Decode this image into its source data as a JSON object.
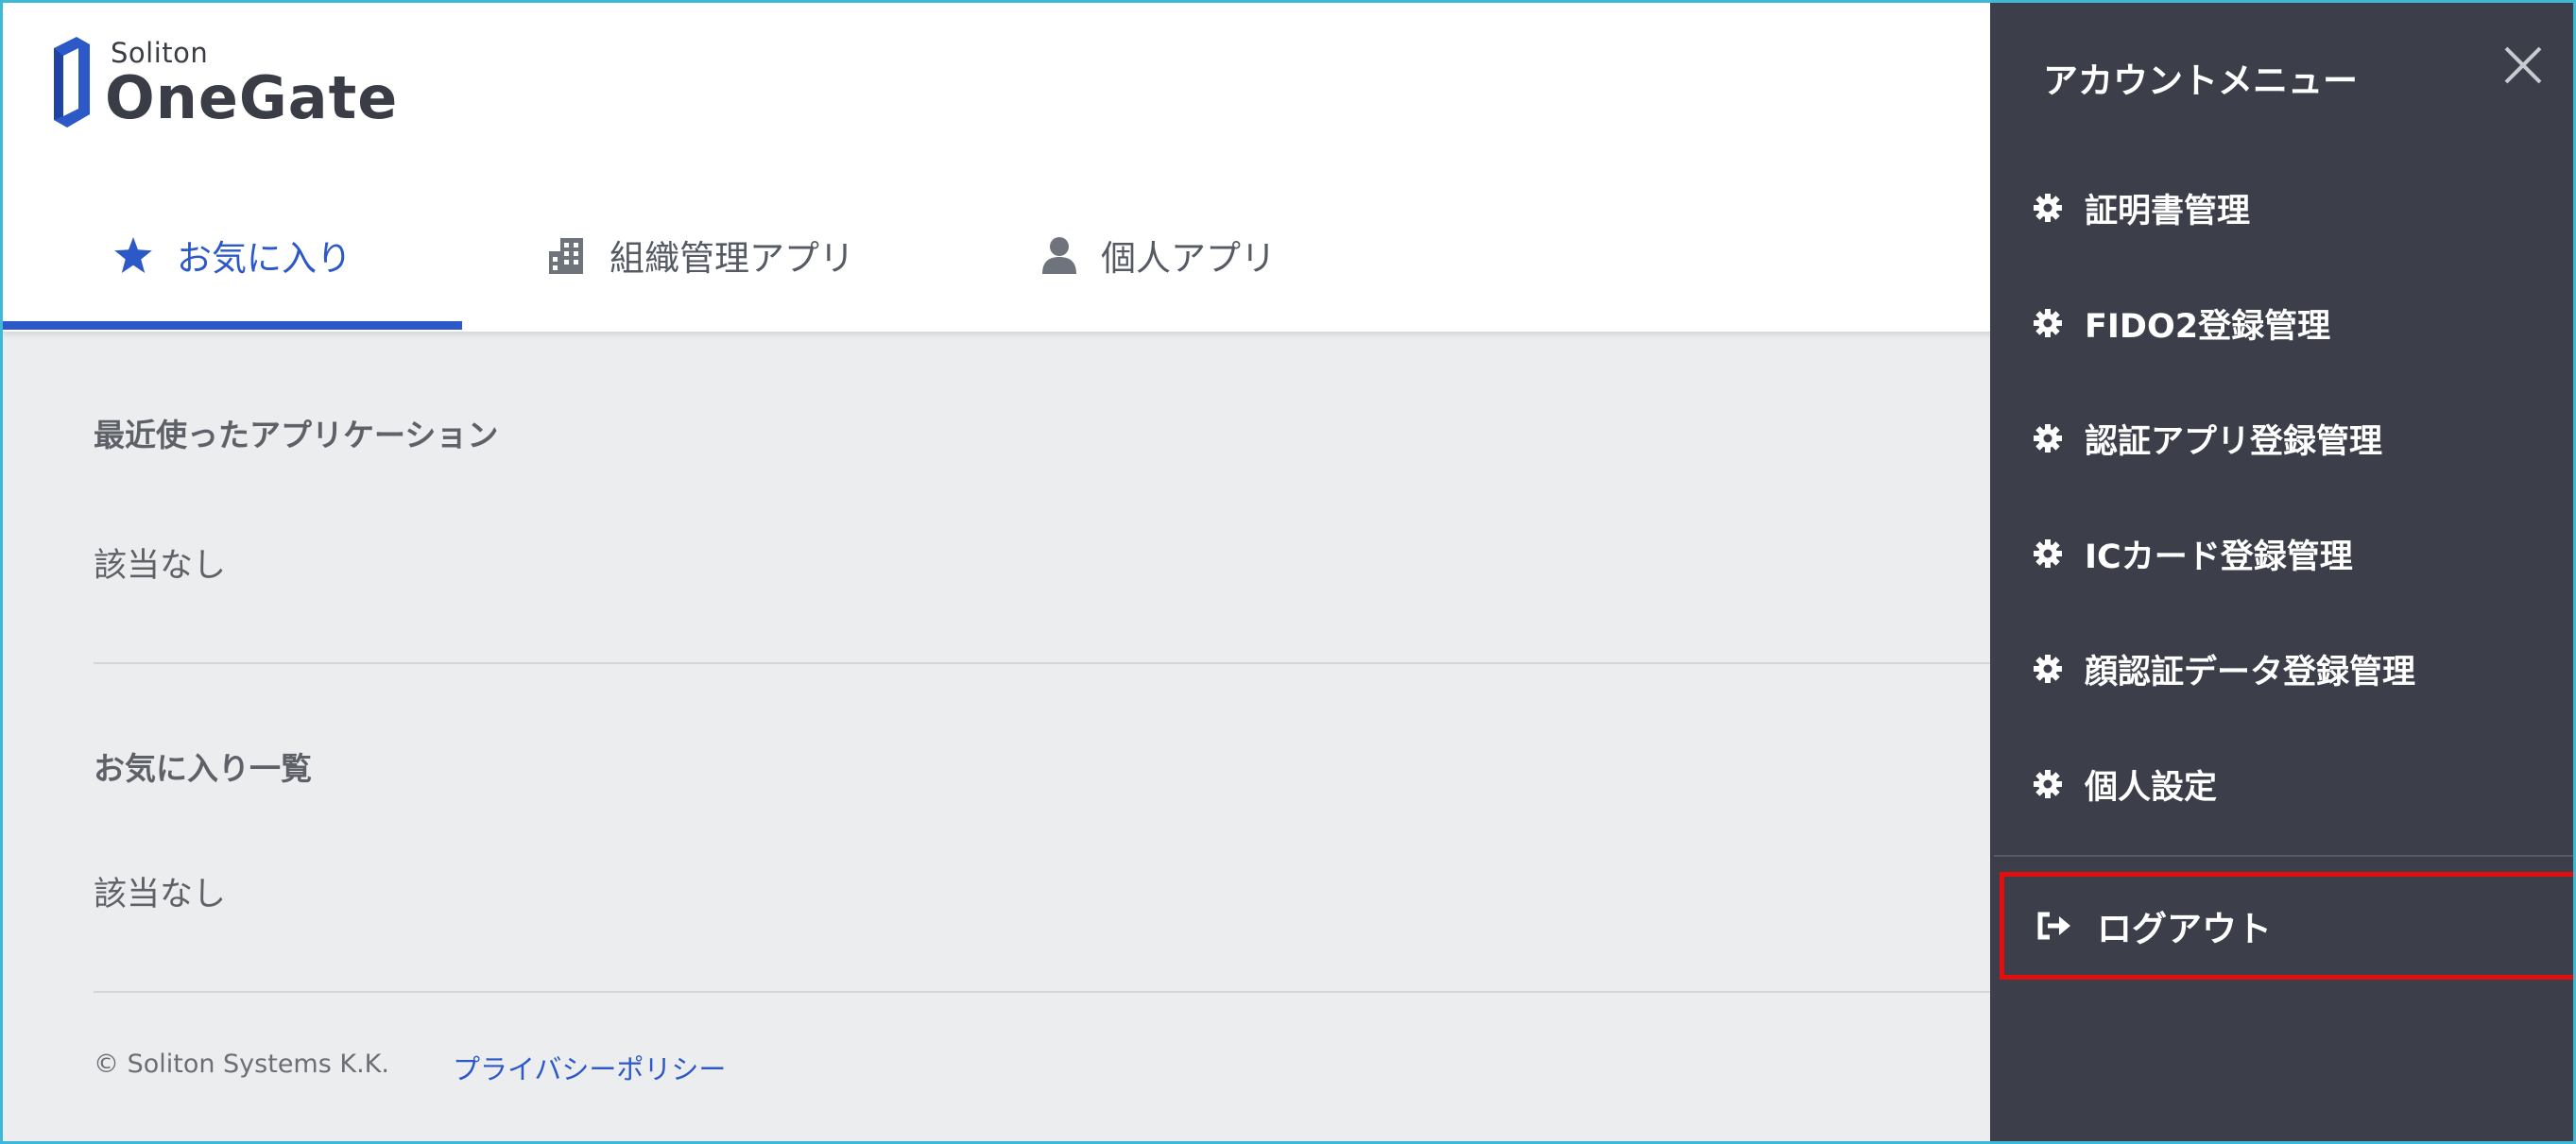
{
  "brand": {
    "small": "Soliton",
    "big": "OneGate",
    "color": "#2d59c8"
  },
  "tabs": [
    {
      "label": "お気に入り",
      "icon": "star-icon",
      "active": true
    },
    {
      "label": "組織管理アプリ",
      "icon": "building-icon",
      "active": false
    },
    {
      "label": "個人アプリ",
      "icon": "person-icon",
      "active": false
    }
  ],
  "main": {
    "recent_title": "最近使ったアプリケーション",
    "recent_empty": "該当なし",
    "favorites_title": "お気に入り一覧",
    "favorites_empty": "該当なし"
  },
  "footer": {
    "copyright": "© Soliton Systems K.K.",
    "privacy": "プライバシーポリシー"
  },
  "account_menu": {
    "title": "アカウントメニュー",
    "close_icon": "close-icon",
    "items": [
      {
        "label": "証明書管理",
        "icon": "gear-icon"
      },
      {
        "label": "FIDO2登録管理",
        "icon": "gear-icon"
      },
      {
        "label": "認証アプリ登録管理",
        "icon": "gear-icon"
      },
      {
        "label": "ICカード登録管理",
        "icon": "gear-icon"
      },
      {
        "label": "顔認証データ登録管理",
        "icon": "gear-icon"
      },
      {
        "label": "個人設定",
        "icon": "gear-icon"
      }
    ],
    "logout": {
      "label": "ログアウト",
      "icon": "logout-icon"
    },
    "highlight_color": "#e30d0d"
  }
}
